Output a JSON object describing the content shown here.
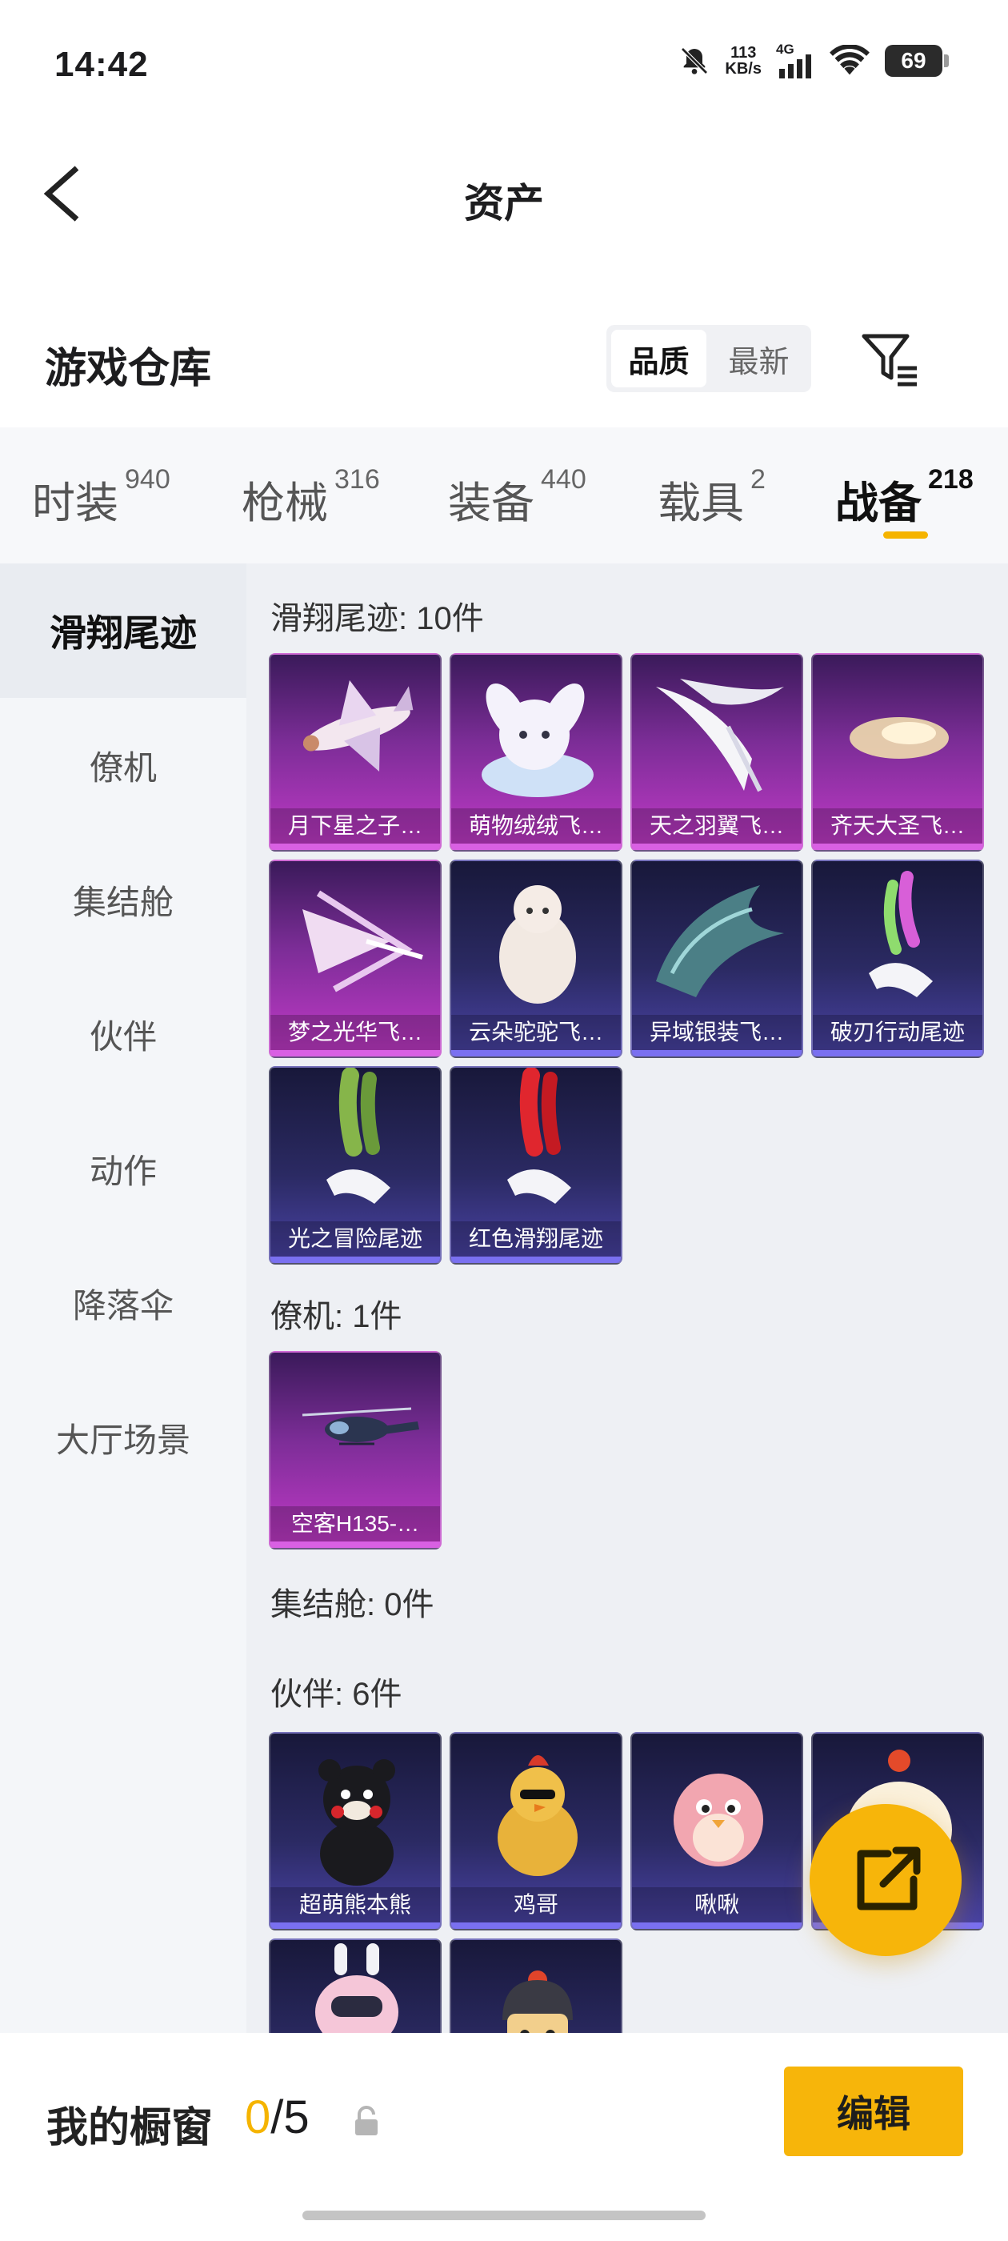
{
  "status_bar": {
    "time": "14:42",
    "net_speed_value": "113",
    "net_speed_unit": "KB/s",
    "network": "4G",
    "battery": "69",
    "icons": [
      "bell-off-icon",
      "signal-icon",
      "wifi-icon",
      "battery-icon"
    ]
  },
  "header": {
    "title": "资产",
    "back_icon": "chevron-left-icon"
  },
  "warehouse": {
    "title": "游戏仓库",
    "sort_options": [
      "品质",
      "最新"
    ],
    "sort_selected": "品质",
    "filter_icon": "filter-icon"
  },
  "categories": [
    {
      "label": "时装",
      "count": "940"
    },
    {
      "label": "枪械",
      "count": "316"
    },
    {
      "label": "装备",
      "count": "440"
    },
    {
      "label": "载具",
      "count": "2"
    },
    {
      "label": "战备",
      "count": "218"
    }
  ],
  "active_category": "战备",
  "sidebar": {
    "items": [
      "滑翔尾迹",
      "僚机",
      "集结舱",
      "伙伴",
      "动作",
      "降落伞",
      "大厅场景"
    ],
    "active": "滑翔尾迹"
  },
  "sections": [
    {
      "title": "滑翔尾迹: 10件",
      "items": [
        {
          "label": "月下星之子…",
          "rarity": "pink"
        },
        {
          "label": "萌物绒绒飞…",
          "rarity": "pink"
        },
        {
          "label": "天之羽翼飞…",
          "rarity": "pink"
        },
        {
          "label": "齐天大圣飞…",
          "rarity": "pink"
        },
        {
          "label": "梦之光华飞…",
          "rarity": "pink"
        },
        {
          "label": "云朵驼驼飞…",
          "rarity": "blue"
        },
        {
          "label": "异域银装飞…",
          "rarity": "blue"
        },
        {
          "label": "破刃行动尾迹",
          "rarity": "blue"
        },
        {
          "label": "光之冒险尾迹",
          "rarity": "blue"
        },
        {
          "label": "红色滑翔尾迹",
          "rarity": "blue"
        }
      ]
    },
    {
      "title": "僚机: 1件",
      "items": [
        {
          "label": "空客H135-…",
          "rarity": "pink"
        }
      ]
    },
    {
      "title": "集结舱: 0件",
      "items": []
    },
    {
      "title": "伙伴: 6件",
      "items": [
        {
          "label": "超萌熊本熊",
          "rarity": "blue"
        },
        {
          "label": "鸡哥",
          "rarity": "blue"
        },
        {
          "label": "啾啾",
          "rarity": "blue"
        },
        {
          "label": "",
          "rarity": "blue"
        },
        {
          "label": "",
          "rarity": "blue"
        },
        {
          "label": "",
          "rarity": "blue"
        }
      ]
    }
  ],
  "fab": {
    "icon": "share-external-icon"
  },
  "bottom_bar": {
    "showcase_label": "我的橱窗",
    "showcase_current": "0",
    "showcase_total": "/5",
    "lock_icon": "lock-icon",
    "edit_label": "编辑"
  },
  "colors": {
    "accent": "#f7b50a",
    "rare_pink": "#c23ac8",
    "rare_blue": "#4a43a6"
  }
}
